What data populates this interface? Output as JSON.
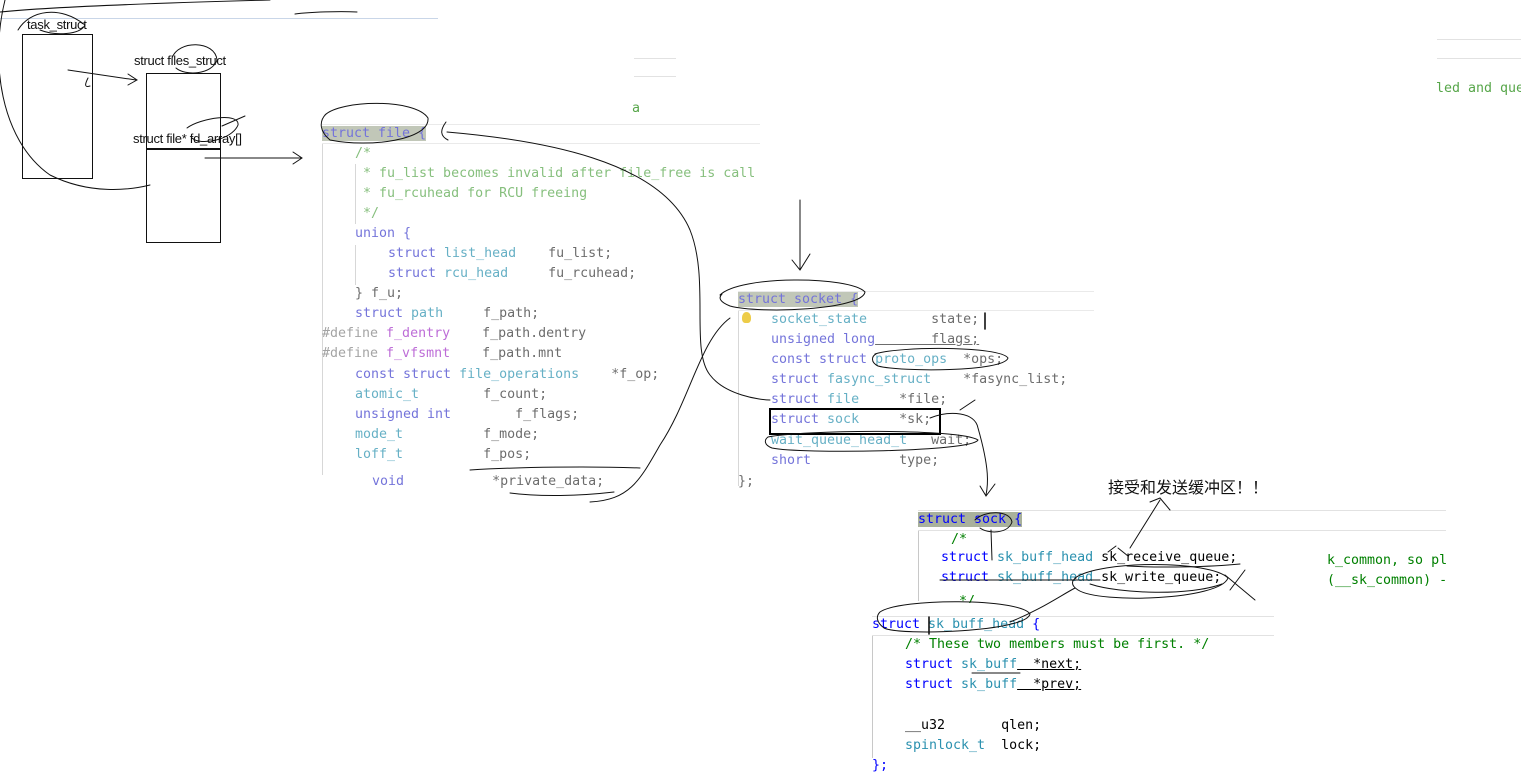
{
  "boxes": {
    "task_struct": "task_struct",
    "files_struct": "struct files_struct",
    "fd_array": "struct file* fd_array[]"
  },
  "annotation": "接受和发送缓冲区！！",
  "stray": {
    "a": "a",
    "right_top": "led and que",
    "right_mid1": "k_common, so pl",
    "right_mid2": "(__sk_common) -"
  },
  "file_struct": {
    "l0": "struct file {",
    "l1": "/*",
    "l2": " * fu_list becomes invalid after file_free is call",
    "l3": " * fu_rcuhead for RCU freeing",
    "l4": " */",
    "l5": "union {",
    "l6a": "struct ",
    "l6b": "list_head",
    "l6c": "    fu_list;",
    "l7a": "struct ",
    "l7b": "rcu_head",
    "l7c": "     fu_rcuhead;",
    "l8": "} f_u;",
    "l9a": "struct ",
    "l9b": "path",
    "l9c": "     f_path;",
    "l10a": "#define ",
    "l10b": "f_dentry",
    "l10c": "    f_path.dentry",
    "l11a": "#define ",
    "l11b": "f_vfsmnt",
    "l11c": "    f_path.mnt",
    "l12a": "const struct ",
    "l12b": "file_operations",
    "l12c": "    *f_op;",
    "l13a": "atomic_t",
    "l13b": "        f_count;",
    "l14a": "unsigned int",
    "l14b": "        f_flags;",
    "l15a": "mode_t",
    "l15b": "          f_mode;",
    "l16a": "loff_t",
    "l16b": "          f_pos;",
    "l17a": "void",
    "l17b": "           *private_data;"
  },
  "socket_struct": {
    "l0": "struct socket {",
    "l1a": "socket_state",
    "l1b": "        state;",
    "l2a": "unsigned long",
    "l2b": "       flags;",
    "l3a": "const struct ",
    "l3b": "proto_ops",
    "l3c": "  *ops;",
    "l4a": "struct ",
    "l4b": "fasync_struct",
    "l4c": "    *fasync_list;",
    "l5a": "struct ",
    "l5b": "file",
    "l5c": "     *file;",
    "l6a": "struct ",
    "l6b": "sock",
    "l6c": "     *sk;",
    "l7a": "wait_queue_head_t",
    "l7b": "   wait;",
    "l8a": "short",
    "l8b": "           type;",
    "l9": "};"
  },
  "sock_struct": {
    "l0": "struct sock {",
    "l1": "/*",
    "l2a": "struct ",
    "l2b": "sk_buff_head",
    "l2c": " sk_receive_queue;",
    "l3a": "struct ",
    "l3b": "sk_buff_head",
    "l3c": " sk_write_queue;",
    "l4": " */"
  },
  "skbh_struct": {
    "l0a": "struct ",
    "l0b": "sk_buff_head",
    "l0c": " {",
    "l1": "/* These two members must be first. */",
    "l2a": "struct ",
    "l2b": "sk_buff",
    "l2c": "  *next;",
    "l3a": "struct ",
    "l3b": "sk_buff",
    "l3c": "  *prev;",
    "l4a": "__u32",
    "l4b": "       qlen;",
    "l5a": "spinlock_t",
    "l5b": "  lock;",
    "l6": "};"
  }
}
